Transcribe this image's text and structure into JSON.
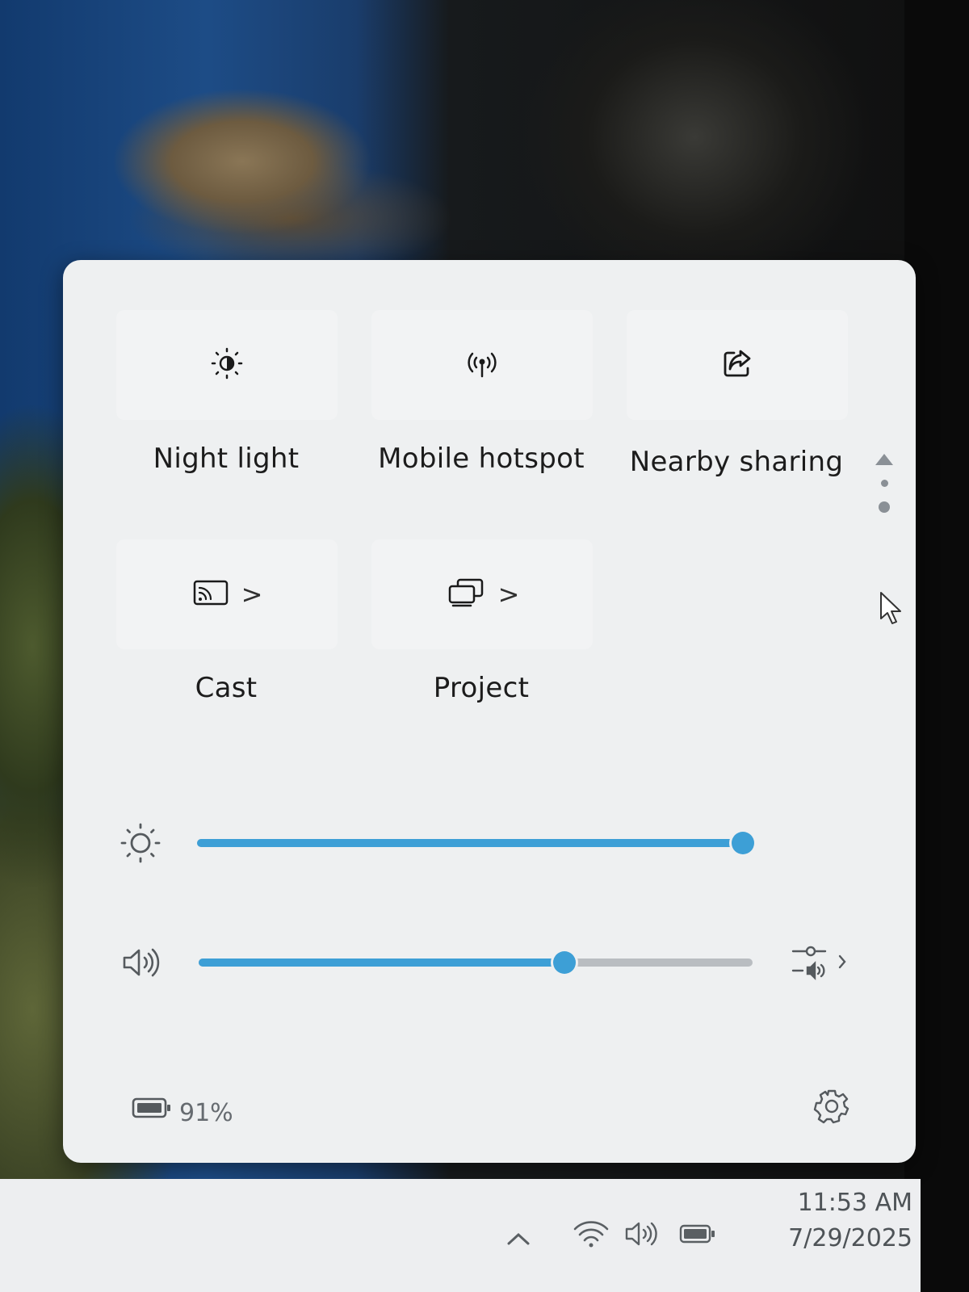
{
  "quick_settings": {
    "tiles": [
      {
        "label": "Night light",
        "icon": "night-light-icon",
        "has_chevron": false
      },
      {
        "label": "Mobile hotspot",
        "icon": "hotspot-icon",
        "has_chevron": false
      },
      {
        "label": "Nearby sharing",
        "icon": "share-icon",
        "has_chevron": false
      },
      {
        "label": "Cast",
        "icon": "cast-icon",
        "has_chevron": true
      },
      {
        "label": "Project",
        "icon": "project-icon",
        "has_chevron": true
      }
    ],
    "chevron_glyph": ">",
    "pages": {
      "count": 2,
      "current": 2
    },
    "brightness": {
      "icon": "brightness-icon",
      "level": 0.98
    },
    "volume": {
      "icon": "speaker-icon",
      "level": 0.66,
      "mixer_icon": "volume-mixer-icon"
    },
    "battery": {
      "icon": "battery-icon",
      "percent_text": "91%"
    },
    "settings_icon": "gear-icon"
  },
  "taskbar": {
    "tray_icons": [
      "chevron-up-icon",
      "wifi-icon",
      "speaker-icon",
      "battery-icon"
    ],
    "time": "11:53 AM",
    "date": "7/29/2025"
  },
  "colors": {
    "accent": "#3d9fd6",
    "panel": "#eef0f1",
    "tile": "#f2f3f4"
  }
}
